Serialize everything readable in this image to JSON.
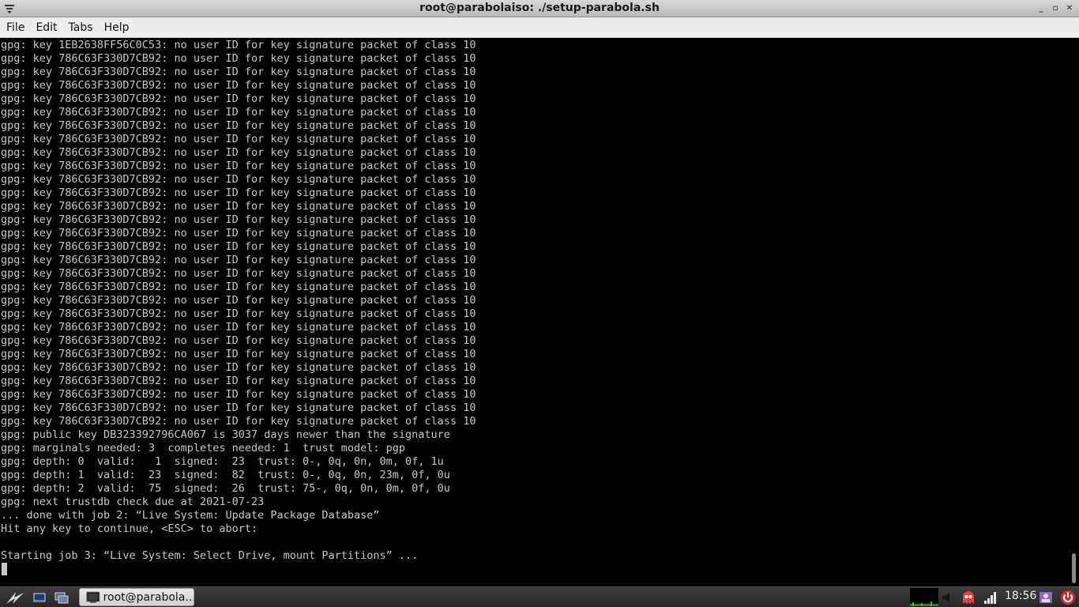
{
  "window": {
    "title": "root@parabolaiso: ./setup-parabola.sh",
    "controls": {
      "minimize": "_",
      "maximize": "▫",
      "close": "✕"
    }
  },
  "menubar": {
    "items": [
      "File",
      "Edit",
      "Tabs",
      "Help"
    ]
  },
  "terminal": {
    "lines": [
      "gpg: key 1EB2638FF56C0C53: no user ID for key signature packet of class 10",
      "gpg: key 786C63F330D7CB92: no user ID for key signature packet of class 10",
      "gpg: key 786C63F330D7CB92: no user ID for key signature packet of class 10",
      "gpg: key 786C63F330D7CB92: no user ID for key signature packet of class 10",
      "gpg: key 786C63F330D7CB92: no user ID for key signature packet of class 10",
      "gpg: key 786C63F330D7CB92: no user ID for key signature packet of class 10",
      "gpg: key 786C63F330D7CB92: no user ID for key signature packet of class 10",
      "gpg: key 786C63F330D7CB92: no user ID for key signature packet of class 10",
      "gpg: key 786C63F330D7CB92: no user ID for key signature packet of class 10",
      "gpg: key 786C63F330D7CB92: no user ID for key signature packet of class 10",
      "gpg: key 786C63F330D7CB92: no user ID for key signature packet of class 10",
      "gpg: key 786C63F330D7CB92: no user ID for key signature packet of class 10",
      "gpg: key 786C63F330D7CB92: no user ID for key signature packet of class 10",
      "gpg: key 786C63F330D7CB92: no user ID for key signature packet of class 10",
      "gpg: key 786C63F330D7CB92: no user ID for key signature packet of class 10",
      "gpg: key 786C63F330D7CB92: no user ID for key signature packet of class 10",
      "gpg: key 786C63F330D7CB92: no user ID for key signature packet of class 10",
      "gpg: key 786C63F330D7CB92: no user ID for key signature packet of class 10",
      "gpg: key 786C63F330D7CB92: no user ID for key signature packet of class 10",
      "gpg: key 786C63F330D7CB92: no user ID for key signature packet of class 10",
      "gpg: key 786C63F330D7CB92: no user ID for key signature packet of class 10",
      "gpg: key 786C63F330D7CB92: no user ID for key signature packet of class 10",
      "gpg: key 786C63F330D7CB92: no user ID for key signature packet of class 10",
      "gpg: key 786C63F330D7CB92: no user ID for key signature packet of class 10",
      "gpg: key 786C63F330D7CB92: no user ID for key signature packet of class 10",
      "gpg: key 786C63F330D7CB92: no user ID for key signature packet of class 10",
      "gpg: key 786C63F330D7CB92: no user ID for key signature packet of class 10",
      "gpg: key 786C63F330D7CB92: no user ID for key signature packet of class 10",
      "gpg: key 786C63F330D7CB92: no user ID for key signature packet of class 10",
      "gpg: public key DB323392796CA067 is 3037 days newer than the signature",
      "gpg: marginals needed: 3  completes needed: 1  trust model: pgp",
      "gpg: depth: 0  valid:   1  signed:  23  trust: 0-, 0q, 0n, 0m, 0f, 1u",
      "gpg: depth: 1  valid:  23  signed:  82  trust: 0-, 0q, 0n, 23m, 0f, 0u",
      "gpg: depth: 2  valid:  75  signed:  26  trust: 75-, 0q, 0n, 0m, 0f, 0u",
      "gpg: next trustdb check due at 2021-07-23",
      "... done with job 2: “Live System: Update Package Database”",
      "Hit any key to continue, <ESC> to abort:",
      "",
      "Starting job 3: “Live System: Select Drive, mount Partitions” ..."
    ]
  },
  "taskbar": {
    "task_label": "root@parabola...",
    "clock": "18:56"
  },
  "colors": {
    "terminal_bg": "#000000",
    "terminal_fg": "#c8c8c8",
    "taskbar_bg": "#2e2e2e"
  }
}
